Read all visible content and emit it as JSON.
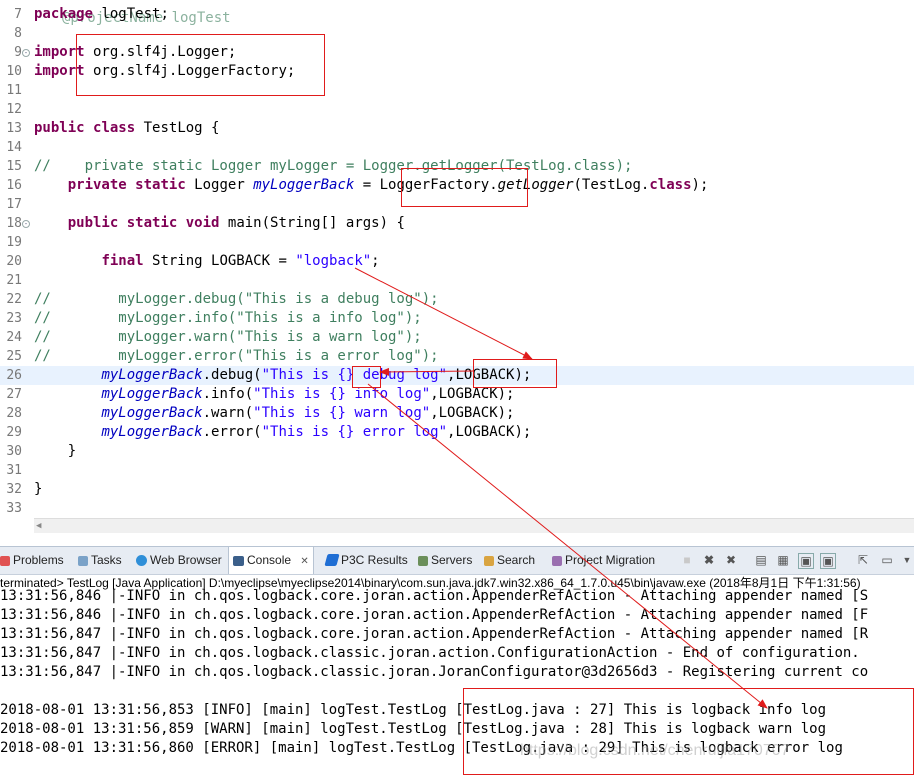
{
  "editor": {
    "header_fragment": "@projectName logTest",
    "lines": [
      {
        "n": "7",
        "html": "<span class=\"kw\">package</span> logTest;"
      },
      {
        "n": "8",
        "html": ""
      },
      {
        "n": "9",
        "fold": true,
        "html": "<span class=\"kw\">import</span> org.slf4j.Logger;"
      },
      {
        "n": "10",
        "html": "<span class=\"kw\">import</span> org.slf4j.LoggerFactory;"
      },
      {
        "n": "11",
        "html": ""
      },
      {
        "n": "12",
        "html": ""
      },
      {
        "n": "13",
        "html": "<span class=\"kw\">public</span> <span class=\"kw\">class</span> TestLog {"
      },
      {
        "n": "14",
        "html": ""
      },
      {
        "n": "15",
        "html": "<span class=\"cmt\">//    private static Logger myLogger = Logger.getLogger(TestLog.class);</span>"
      },
      {
        "n": "16",
        "html": "    <span class=\"kw\">private</span> <span class=\"kw\">static</span> Logger <span class=\"fld\">myLoggerBack</span> = LoggerFactory.<span class=\"stm\">getLogger</span>(TestLog.<span class=\"kw\">class</span>);"
      },
      {
        "n": "17",
        "html": ""
      },
      {
        "n": "18",
        "fold": true,
        "html": "    <span class=\"kw\">public</span> <span class=\"kw\">static</span> <span class=\"kw\">void</span> main(String[] args) {"
      },
      {
        "n": "19",
        "html": ""
      },
      {
        "n": "20",
        "html": "        <span class=\"kw\">final</span> String LOGBACK = <span class=\"str\">\"logback\"</span>;"
      },
      {
        "n": "21",
        "html": ""
      },
      {
        "n": "22",
        "html": "<span class=\"cmt\">//        myLogger.debug(\"This is a debug log\");</span>"
      },
      {
        "n": "23",
        "html": "<span class=\"cmt\">//        myLogger.info(\"This is a info log\");</span>"
      },
      {
        "n": "24",
        "html": "<span class=\"cmt\">//        myLogger.warn(\"This is a warn log\");</span>"
      },
      {
        "n": "25",
        "html": "<span class=\"cmt\">//        myLogger.error(\"This is a error log\");</span>"
      },
      {
        "n": "26",
        "current": true,
        "html": "        <span class=\"fld\">myLoggerBack</span>.debug(<span class=\"str\">\"This is {} debug log\"</span>,LOGBACK);"
      },
      {
        "n": "27",
        "html": "        <span class=\"fld\">myLoggerBack</span>.info(<span class=\"str\">\"This is {} info log\"</span>,LOGBACK);"
      },
      {
        "n": "28",
        "html": "        <span class=\"fld\">myLoggerBack</span>.warn(<span class=\"str\">\"This is {} warn log\"</span>,LOGBACK);"
      },
      {
        "n": "29",
        "html": "        <span class=\"fld\">myLoggerBack</span>.error(<span class=\"str\">\"This is {} error log\"</span>,LOGBACK);"
      },
      {
        "n": "30",
        "html": "    }"
      },
      {
        "n": "31",
        "html": ""
      },
      {
        "n": "32",
        "html": "}"
      },
      {
        "n": "33",
        "html": ""
      }
    ]
  },
  "panel": {
    "tabs": [
      "Problems",
      "Tasks",
      "Web Browser",
      "Console",
      "P3C Results",
      "Servers",
      "Search",
      "Project Migration"
    ],
    "active_tab": "Console",
    "close_glyph": "✕",
    "console_title": "terminated> TestLog [Java Application] D:\\myeclipse\\myeclipse2014\\binary\\com.sun.java.jdk7.win32.x86_64_1.7.0.u45\\bin\\javaw.exe (2018年8月1日 下午1:31:56)"
  },
  "console": {
    "lines": [
      "13:31:56,846 |-INFO in ch.qos.logback.core.joran.action.AppenderRefAction - Attaching appender named [S",
      "13:31:56,846 |-INFO in ch.qos.logback.core.joran.action.AppenderRefAction - Attaching appender named [F",
      "13:31:56,847 |-INFO in ch.qos.logback.core.joran.action.AppenderRefAction - Attaching appender named [R",
      "13:31:56,847 |-INFO in ch.qos.logback.classic.joran.action.ConfigurationAction - End of configuration.",
      "13:31:56,847 |-INFO in ch.qos.logback.classic.joran.JoranConfigurator@3d2656d3 - Registering current co",
      "",
      "2018-08-01 13:31:56,853 [INFO] [main] logTest.TestLog [TestLog.java : 27] This is logback info log",
      "2018-08-01 13:31:56,859 [WARN] [main] logTest.TestLog [TestLog.java : 28] This is logback warn log",
      "2018-08-01 13:31:56,860 [ERROR] [main] logTest.TestLog [TestLog.java : 29] This is logback error log"
    ]
  },
  "watermark": "https://blog.csdn.net/chenruijia170707",
  "colors": {
    "annotation": "#e01b1b",
    "keyword": "#7f0055",
    "string": "#2a00ff",
    "comment": "#3f7f5f",
    "field": "#0000c0"
  }
}
